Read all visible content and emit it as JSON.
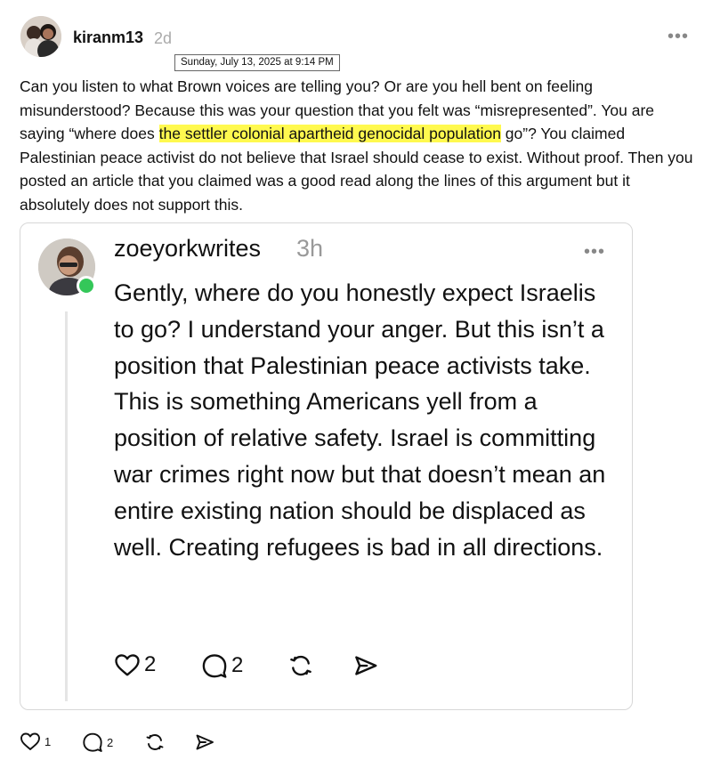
{
  "post": {
    "username": "kiranm13",
    "age": "2d",
    "tooltip": "Sunday, July 13, 2025 at 9:14 PM",
    "text_before": "Can you listen to what Brown voices are telling you? Or are you hell bent on feeling misunderstood? Because this was your question that you felt was “misrepresented”. You are saying “where does ",
    "text_highlight": "the settler colonial apartheid genocidal population",
    "text_after": " go”? You claimed Palestinian peace activist do not believe that Israel should cease to exist. Without proof. Then you posted an article that you claimed was a good read along the lines of this argument but it absolutely does not support this.",
    "likes": "1",
    "replies": "2"
  },
  "quote": {
    "username": "zoeyorkwrites",
    "age": "3h",
    "text": "Gently, where do you honestly expect Israelis to go? I understand your anger. But this isn’t a position that Palestinian peace activists take. This is something Americans yell from a position of relative safety. Israel is committing war crimes right now but that doesn’t mean an entire existing nation should be displaced as well. Creating refugees is bad in all directions.",
    "likes": "2",
    "replies": "2"
  },
  "colors": {
    "highlight": "#fff94f",
    "online": "#34c759"
  },
  "icons": [
    "more-icon",
    "heart-icon",
    "comment-icon",
    "repost-icon",
    "share-icon"
  ]
}
